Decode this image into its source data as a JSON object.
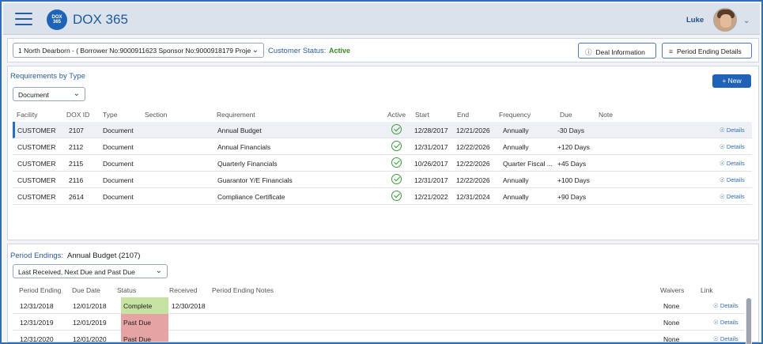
{
  "app": {
    "logo_text": "DOX 365",
    "title": "DOX 365"
  },
  "user": {
    "name": "Luke"
  },
  "loan_bar": {
    "borrower_select": "1 North Dearborn - ( Borrower No:9000911623 Sponsor No:9000918179 Proje",
    "customer_status_label": "Customer Status:",
    "customer_status_value": "Active",
    "deal_info_label": "Deal Information",
    "period_ending_details_label": "Period Ending Details"
  },
  "requirements": {
    "title": "Requirements by Type",
    "type_filter": "Document",
    "new_button": "New",
    "columns": [
      "Facility",
      "DOX ID",
      "Type",
      "Section",
      "Requirement",
      "Active",
      "Start",
      "End",
      "Frequency",
      "Due",
      "Note"
    ],
    "details_label": "Details",
    "rows": [
      {
        "facility": "CUSTOMER",
        "dox_id": "2107",
        "type": "Document",
        "section": "",
        "requirement": "Annual Budget",
        "active": true,
        "start": "12/28/2017",
        "end": "12/21/2026",
        "frequency": "Annually",
        "due": "-30 Days",
        "note": ""
      },
      {
        "facility": "CUSTOMER",
        "dox_id": "2112",
        "type": "Document",
        "section": "",
        "requirement": "Annual Financials",
        "active": true,
        "start": "12/31/2017",
        "end": "12/22/2026",
        "frequency": "Annually",
        "due": "+120 Days",
        "note": ""
      },
      {
        "facility": "CUSTOMER",
        "dox_id": "2115",
        "type": "Document",
        "section": "",
        "requirement": "Quarterly Financials",
        "active": true,
        "start": "10/26/2017",
        "end": "12/22/2026",
        "frequency": "Quarter Fiscal ...",
        "due": "+45 Days",
        "note": ""
      },
      {
        "facility": "CUSTOMER",
        "dox_id": "2116",
        "type": "Document",
        "section": "",
        "requirement": "Guarantor Y/E Financials",
        "active": true,
        "start": "12/31/2017",
        "end": "12/22/2026",
        "frequency": "Annually",
        "due": "+100 Days",
        "note": ""
      },
      {
        "facility": "CUSTOMER",
        "dox_id": "2614",
        "type": "Document",
        "section": "",
        "requirement": "Compliance Certificate",
        "active": true,
        "start": "12/21/2022",
        "end": "12/31/2024",
        "frequency": "Annually",
        "due": "+90 Days",
        "note": ""
      }
    ]
  },
  "period_endings": {
    "title": "Period Endings:",
    "subtitle": "Annual Budget (2107)",
    "filter": "Last Received, Next Due and Past Due",
    "columns": [
      "Period Ending",
      "Due Date",
      "Status",
      "Received",
      "Period Ending Notes",
      "Waivers",
      "Link"
    ],
    "details_label": "Details",
    "status_colors": {
      "Complete": "#c6e3a3",
      "Past Due": "#e6a3a3"
    },
    "rows": [
      {
        "period_ending": "12/31/2018",
        "due_date": "12/01/2018",
        "status": "Complete",
        "received": "12/30/2018",
        "notes": "",
        "waivers": "None"
      },
      {
        "period_ending": "12/31/2019",
        "due_date": "12/01/2019",
        "status": "Past Due",
        "received": "",
        "notes": "",
        "waivers": "None"
      },
      {
        "period_ending": "12/31/2020",
        "due_date": "12/01/2020",
        "status": "Past Due",
        "received": "",
        "notes": "",
        "waivers": "None"
      }
    ]
  }
}
